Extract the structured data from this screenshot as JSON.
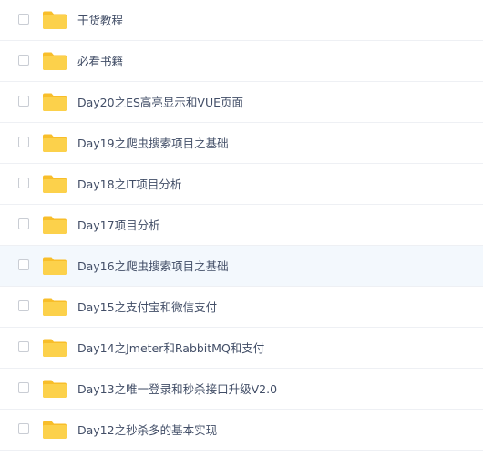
{
  "file_list": {
    "items": [
      {
        "name": "干货教程",
        "icon": "folder-icon"
      },
      {
        "name": "必看书籍",
        "icon": "folder-icon"
      },
      {
        "name": "Day20之ES高亮显示和VUE页面",
        "icon": "folder-icon"
      },
      {
        "name": "Day19之爬虫搜索项目之基础",
        "icon": "folder-icon"
      },
      {
        "name": "Day18之IT项目分析",
        "icon": "folder-icon"
      },
      {
        "name": "Day17项目分析",
        "icon": "folder-icon"
      },
      {
        "name": "Day16之爬虫搜索项目之基础",
        "icon": "folder-icon",
        "hovered": true
      },
      {
        "name": "Day15之支付宝和微信支付",
        "icon": "folder-icon"
      },
      {
        "name": "Day14之Jmeter和RabbitMQ和支付",
        "icon": "folder-icon"
      },
      {
        "name": "Day13之唯一登录和秒杀接口升级V2.0",
        "icon": "folder-icon"
      },
      {
        "name": "Day12之秒杀多的基本实现",
        "icon": "folder-icon"
      }
    ]
  },
  "colors": {
    "folder_body": "#fcd14b",
    "folder_tab": "#f8be2a",
    "hover_row": "#f3f8fd",
    "text": "#424e67",
    "divider": "#eef0f4"
  }
}
